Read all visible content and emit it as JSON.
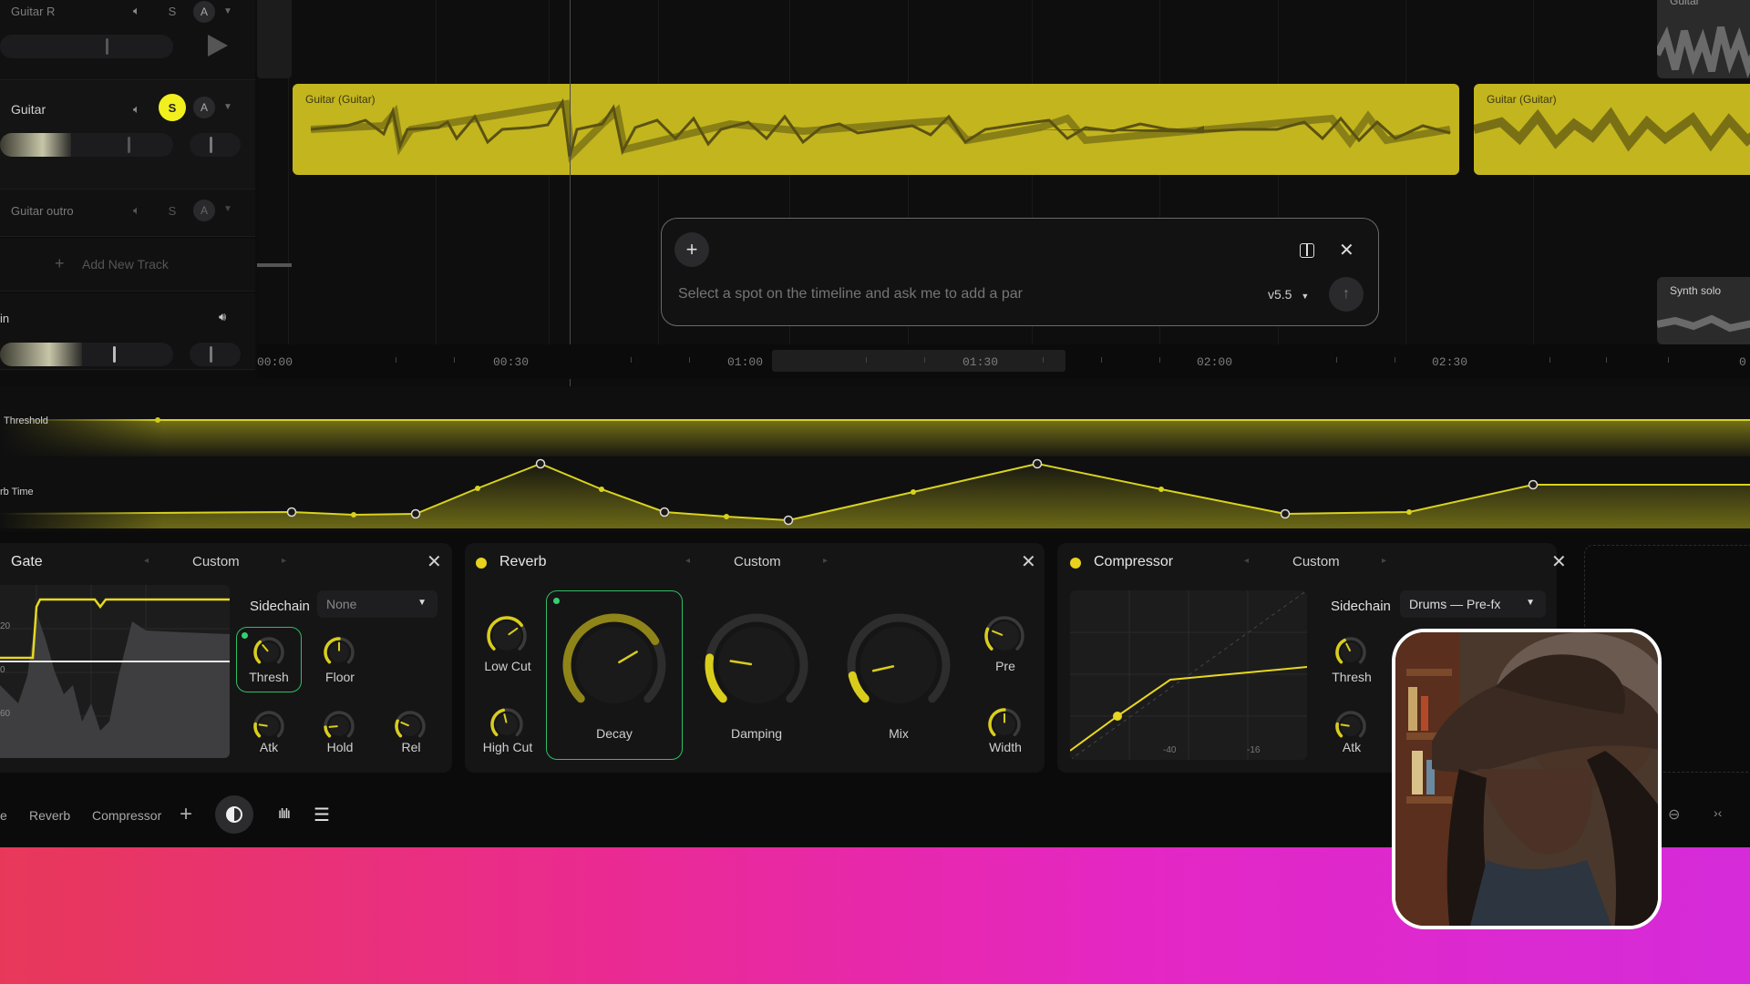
{
  "tracks": [
    {
      "name": "Guitar R",
      "solo": "S",
      "arm": "A"
    },
    {
      "name": "Guitar",
      "solo": "S",
      "arm": "A"
    },
    {
      "name": "Guitar outro",
      "solo": "S",
      "arm": "A"
    }
  ],
  "add_track_label": "Add New Track",
  "main_track_name": "in",
  "clips": {
    "main_left": "Guitar (Guitar)",
    "main_right": "Guitar (Guitar)",
    "top_right": "Guitar",
    "synth": "Synth solo"
  },
  "prompt": {
    "placeholder": "Select a spot on the timeline and ask me to add a par",
    "version": "v5.5"
  },
  "ruler": [
    "00:00",
    "00:30",
    "01:00",
    "01:30",
    "02:00",
    "02:30",
    "0"
  ],
  "automation": {
    "lane1": "Threshold",
    "lane2": "rb Time"
  },
  "gate": {
    "title": "Gate",
    "preset": "Custom",
    "sidechain_label": "Sidechain",
    "sidechain_value": "None",
    "axis_labels": [
      "20",
      "0",
      "60"
    ],
    "knobs": {
      "thresh": "Thresh",
      "floor": "Floor",
      "atk": "Atk",
      "hold": "Hold",
      "rel": "Rel"
    }
  },
  "reverb": {
    "title": "Reverb",
    "preset": "Custom",
    "knobs": {
      "low_cut": "Low Cut",
      "high_cut": "High Cut",
      "decay": "Decay",
      "damping": "Damping",
      "mix": "Mix",
      "pre": "Pre",
      "width": "Width"
    }
  },
  "compressor": {
    "title": "Compressor",
    "preset": "Custom",
    "sidechain_label": "Sidechain",
    "sidechain_value": "Drums — Pre-fx",
    "axis_labels": [
      "-40",
      "-16"
    ],
    "knobs": {
      "thresh": "Thresh",
      "atk": "Atk"
    }
  },
  "bottom_tabs": [
    "e",
    "Reverb",
    "Compressor"
  ],
  "colors": {
    "accent": "#f2ef1f",
    "clip": "#c3b51e",
    "selected": "#2fbd64"
  }
}
